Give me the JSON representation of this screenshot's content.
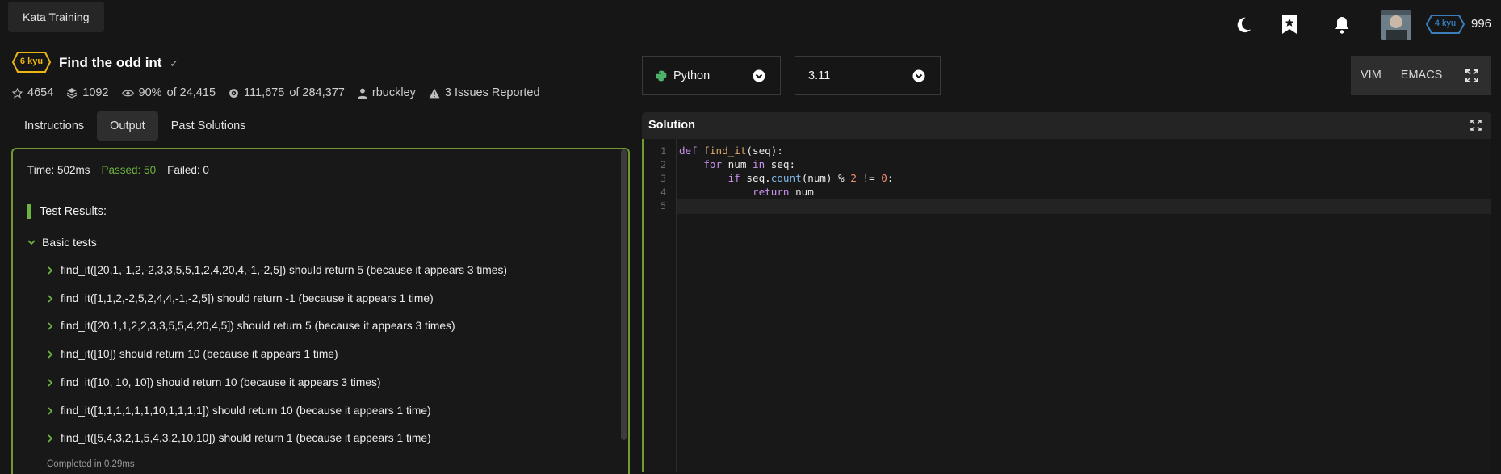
{
  "topbar": {
    "kata_training_label": "Kata Training",
    "icons": [
      "moon-icon",
      "bookmark-star-icon",
      "bell-icon"
    ],
    "rank_label": "4 kyu",
    "honor": "996"
  },
  "kata": {
    "kyu": "6 kyu",
    "title": "Find the odd int",
    "stars": "4654",
    "collections": "1092",
    "satisfaction_pct": "90%",
    "satisfaction_of": "of 24,415",
    "completed": "111,675",
    "completed_of": "of 284,377",
    "author": "rbuckley",
    "issues": "3 Issues Reported"
  },
  "tabs": [
    "Instructions",
    "Output",
    "Past Solutions"
  ],
  "output": {
    "time": "Time: 502ms",
    "passed": "Passed: 50",
    "failed": "Failed: 0",
    "results_title": "Test Results:",
    "group_title": "Basic tests",
    "tests": [
      "find_it([20,1,-1,2,-2,3,3,5,5,1,2,4,20,4,-1,-2,5]) should return 5 (because it appears 3 times)",
      "find_it([1,1,2,-2,5,2,4,4,-1,-2,5]) should return -1 (because it appears 1 time)",
      "find_it([20,1,1,2,2,3,3,5,5,4,20,4,5]) should return 5 (because it appears 3 times)",
      "find_it([10]) should return 10 (because it appears 1 time)",
      "find_it([10, 10, 10]) should return 10 (because it appears 3 times)",
      "find_it([1,1,1,1,1,1,10,1,1,1,1]) should return 10 (because it appears 1 time)",
      "find_it([5,4,3,2,1,5,4,3,2,10,10]) should return 1 (because it appears 1 time)"
    ],
    "completed_in": "Completed in 0.29ms"
  },
  "language": {
    "selected": "Python",
    "version": "3.11"
  },
  "modes": [
    "VIM",
    "EMACS"
  ],
  "solution": {
    "title": "Solution",
    "line_numbers": [
      "1",
      "2",
      "3",
      "4",
      "5"
    ]
  },
  "colors": {
    "accent_green": "#6f9a33",
    "passed_green": "#6db33f",
    "kyu_yellow": "#ecb613",
    "rank_blue": "#3c7ebb"
  }
}
